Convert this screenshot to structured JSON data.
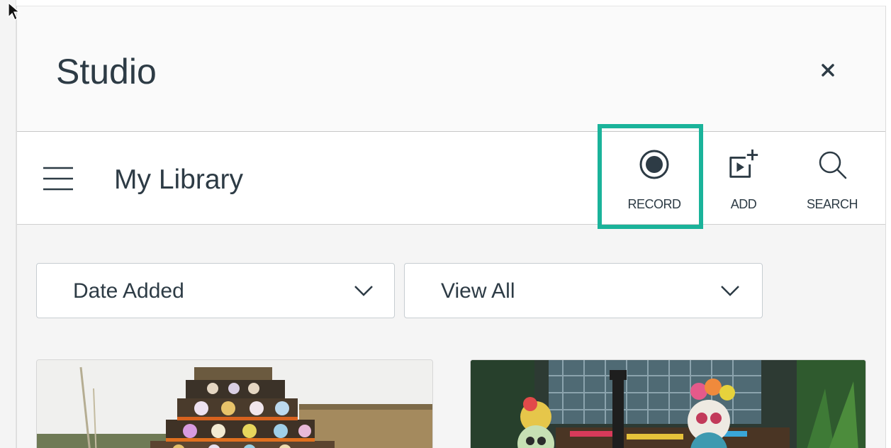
{
  "app": {
    "title": "Studio",
    "close_glyph": "×"
  },
  "toolbar": {
    "library_title": "My Library",
    "tools": {
      "record": {
        "label": "RECORD",
        "icon": "record-icon"
      },
      "add": {
        "label": "ADD",
        "icon": "add-media-icon"
      },
      "search": {
        "label": "SEARCH",
        "icon": "search-icon"
      }
    }
  },
  "filters": {
    "sort": {
      "selected": "Date Added"
    },
    "view": {
      "selected": "View All"
    }
  },
  "colors": {
    "highlight": "#1ab39a",
    "text": "#2d3b45",
    "background": "#f5f5f5"
  }
}
